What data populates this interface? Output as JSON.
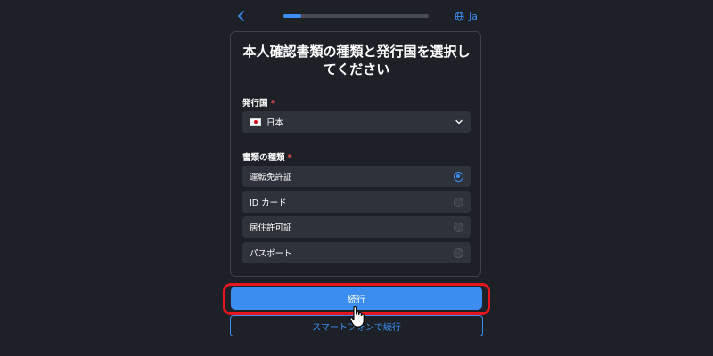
{
  "header": {
    "back_icon": "chevron-left-icon",
    "progress": 0.12,
    "language_icon": "globe-icon",
    "language_label": "Ja",
    "accent_color": "#3b8ef0"
  },
  "card": {
    "title": "本人確認書類の種類と発行国を選択してください",
    "country": {
      "label": "発行国",
      "required_mark": "*",
      "selected_value": "日本",
      "flag_icon": "japan-flag-icon"
    },
    "doc_type": {
      "label": "書類の種類",
      "required_mark": "*",
      "options": [
        {
          "label": "運転免許証",
          "selected": true
        },
        {
          "label": "ID カード",
          "selected": false
        },
        {
          "label": "居住許可証",
          "selected": false
        },
        {
          "label": "パスポート",
          "selected": false
        }
      ]
    }
  },
  "actions": {
    "continue_label": "続行",
    "phone_label": "スマートフォンで続行",
    "highlight_color": "#e5161f"
  },
  "cursor_icon": "hand-pointer-icon"
}
